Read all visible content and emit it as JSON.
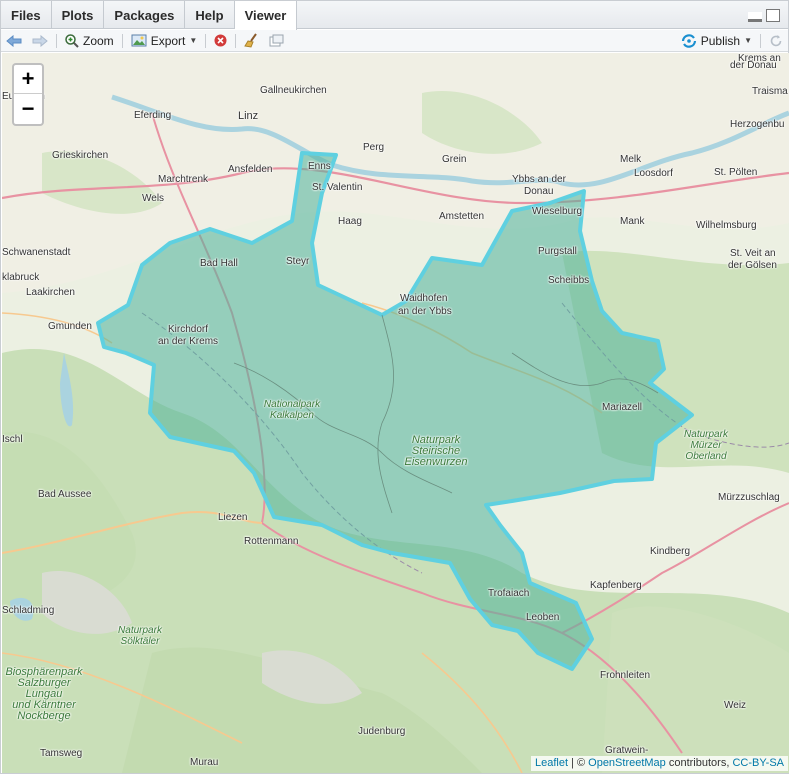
{
  "tabs": [
    "Files",
    "Plots",
    "Packages",
    "Help",
    "Viewer"
  ],
  "toolbar": {
    "zoom": "Zoom",
    "export": "Export",
    "publish": "Publish"
  },
  "zoom_control": {
    "in": "+",
    "out": "−"
  },
  "attribution": {
    "leaflet": "Leaflet",
    "sep1": " | © ",
    "osm": "OpenStreetMap",
    "contrib": " contributors, ",
    "license": "CC-BY-SA"
  },
  "places": [
    {
      "t": "Gallneukirchen"
    },
    {
      "t": "Linz"
    },
    {
      "t": "Euerbach"
    },
    {
      "t": "Eferding"
    },
    {
      "t": "Grieskirchen"
    },
    {
      "t": "Ansfelden"
    },
    {
      "t": "Marchtrenk"
    },
    {
      "t": "Wels"
    },
    {
      "t": "Enns"
    },
    {
      "t": "St. Valentin"
    },
    {
      "t": "Perg"
    },
    {
      "t": "Grein"
    },
    {
      "t": "Ybbs an der"
    },
    {
      "t": "Donau"
    },
    {
      "t": "Melk"
    },
    {
      "t": "Loosdorf"
    },
    {
      "t": "St. Pölten"
    },
    {
      "t": "Herzogenbu"
    },
    {
      "t": "Krems an"
    },
    {
      "t": "der Donau"
    },
    {
      "t": "Traisma"
    },
    {
      "t": "Schwanenstadt"
    },
    {
      "t": "Haag"
    },
    {
      "t": "Amstetten"
    },
    {
      "t": "Wieselburg"
    },
    {
      "t": "Mank"
    },
    {
      "t": "Wilhelmsburg"
    },
    {
      "t": "Bad Hall"
    },
    {
      "t": "Steyr"
    },
    {
      "t": "Purgstall"
    },
    {
      "t": "St. Veit an"
    },
    {
      "t": "der Gölsen"
    },
    {
      "t": "klabruck"
    },
    {
      "t": "Laakirchen"
    },
    {
      "t": "Scheibbs"
    },
    {
      "t": "Waidhofen"
    },
    {
      "t": "an der Ybbs"
    },
    {
      "t": "Gmunden"
    },
    {
      "t": "Kirchdorf"
    },
    {
      "t": "an der Krems"
    },
    {
      "t": "Mariazell"
    },
    {
      "t": "Ischl"
    },
    {
      "t": "Bad Aussee"
    },
    {
      "t": "Liezen"
    },
    {
      "t": "Rottenmann"
    },
    {
      "t": "Mürzzuschlag"
    },
    {
      "t": "Kindberg"
    },
    {
      "t": "Kapfenberg"
    },
    {
      "t": "Trofaiach"
    },
    {
      "t": "Leoben"
    },
    {
      "t": "Schladming"
    },
    {
      "t": "Frohnleiten"
    },
    {
      "t": "Weiz"
    },
    {
      "t": "Judenburg"
    },
    {
      "t": "Murau"
    },
    {
      "t": "Tamsweg"
    },
    {
      "t": "Gratwein-"
    }
  ],
  "parks": [
    {
      "lines": [
        "Nationalpark",
        "Kalkalpen"
      ]
    },
    {
      "lines": [
        "Naturpark",
        "Steirische",
        "Eisenwurzen"
      ]
    },
    {
      "lines": [
        "Naturpark",
        "Mürzer",
        "Oberland"
      ]
    },
    {
      "lines": [
        "Naturpark",
        "Sölktäler"
      ]
    },
    {
      "lines": [
        "Biosphärenpark",
        "Salzburger",
        "Lungau",
        "und Kärntner",
        "Nockberge"
      ]
    }
  ],
  "colors": {
    "region_fill": "#4fb39a",
    "region_stroke": "#5fd0e0",
    "danube": "#aad3df"
  }
}
